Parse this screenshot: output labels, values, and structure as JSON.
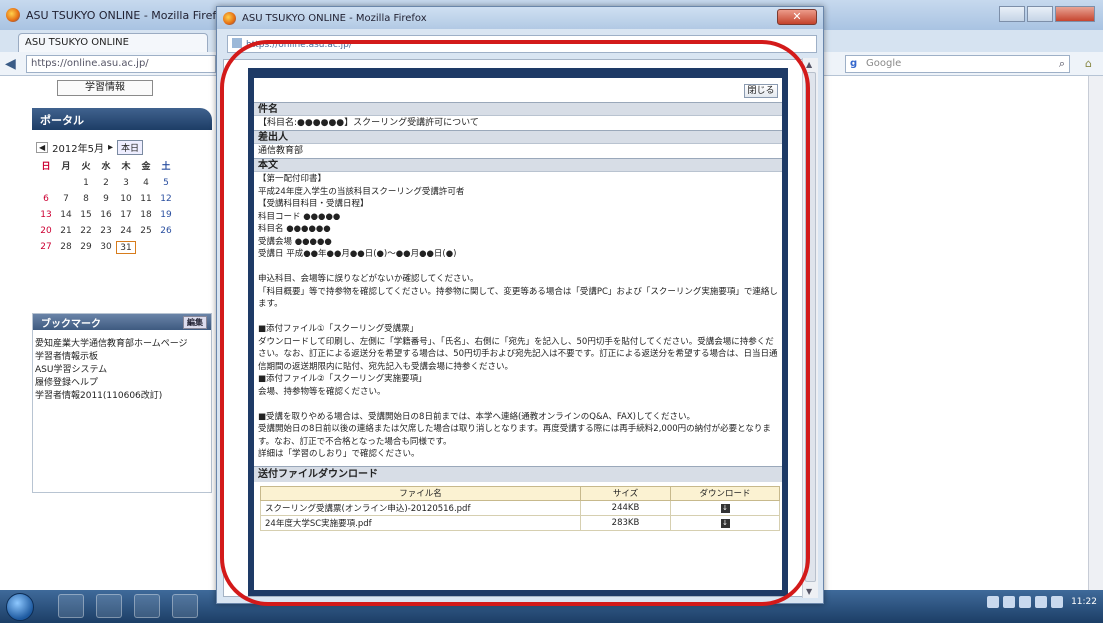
{
  "background_window": {
    "title": "ASU TSUKYO ONLINE - Mozilla Firefox",
    "tab_label": "ASU TSUKYO ONLINE",
    "url": "https://online.asu.ac.jp/",
    "search_placeholder": "Google",
    "study_info_button": "学習情報",
    "portal_title": "ポータル",
    "calendar": {
      "month_label": "2012年5月",
      "today_button": "本日",
      "weekdays": [
        "日",
        "月",
        "火",
        "水",
        "木",
        "金",
        "土"
      ],
      "days": [
        "",
        "",
        "1",
        "2",
        "3",
        "4",
        "5",
        "6",
        "7",
        "8",
        "9",
        "10",
        "11",
        "12",
        "13",
        "14",
        "15",
        "16",
        "17",
        "18",
        "19",
        "20",
        "21",
        "22",
        "23",
        "24",
        "25",
        "26",
        "27",
        "28",
        "29",
        "30",
        "31"
      ],
      "today": "31"
    },
    "bookmark_title": "ブックマーク",
    "bookmark_edit": "編集",
    "bookmarks": [
      "愛知産業大学通信教育部ホームページ",
      "学習者情報示板",
      "ASU学習システム",
      "履修登録ヘルプ",
      "学習者情報2011(110606改訂)"
    ]
  },
  "popup_window": {
    "title": "ASU TSUKYO ONLINE - Mozilla Firefox",
    "url": "https://online.asu.ac.jp/"
  },
  "mail": {
    "close_label": "閉じる",
    "subject_label": "件名",
    "subject_value": "【科目名:●●●●●●】スクーリング受講許可について",
    "sender_label": "差出人",
    "sender_value": "通信教育部",
    "body_label": "本文",
    "body_lines": [
      "【第一配付印書】",
      "平成24年度入学生の当該科目スクーリング受講許可者",
      "【受講科目科目・受講日程】",
      "科目コード ●●●●●",
      "科目名 ●●●●●●",
      "受講会場 ●●●●●",
      "受講日 平成●●年●●月●●日(●)〜●●月●●日(●)",
      "",
      "申込科目、会場等に誤りなどがないか確認してください。",
      "「科目概要」等で持参物を確認してください。持参物に関して、変更等ある場合は「受講PC」および「スクーリング実施要項」で連絡します。",
      "",
      "■添付ファイル①「スクーリング受講票」",
      "ダウンロードして印刷し、左側に「学籍番号」、「氏名」、右側に「宛先」を記入し、50円切手を貼付してください。受講会場に持参ください。なお、訂正による返送分を希望する場合は、50円切手および宛先記入は不要です。訂正による返送分を希望する場合は、日当日通信期間の返送期限内に貼付、宛先記入も受講会場に持参ください。",
      "■添付ファイル②「スクーリング実施要項」",
      "会場、持参物等を確認ください。",
      "",
      "■受講を取りやめる場合は、受講開始日の8日前までは、本学へ連絡(通教オンラインのQ&A、FAX)してください。",
      "受講開始日の8日前以後の連絡または欠席した場合は取り消しとなります。再度受講する際には再手続料2,000円の納付が必要となります。なお、訂正で不合格となった場合も同様です。",
      "詳細は「学習のしおり」で確認ください。"
    ],
    "download_label": "送付ファイルダウンロード",
    "table_headers": [
      "ファイル名",
      "サイズ",
      "ダウンロード"
    ],
    "files": [
      {
        "name": "スクーリング受講票(オンライン申込)-20120516.pdf",
        "size": "244KB"
      },
      {
        "name": "24年度大学SC実施要項.pdf",
        "size": "283KB"
      }
    ]
  },
  "taskbar": {
    "clock": "11:22"
  },
  "colors": {
    "annotation": "#d31a1a",
    "mail_frame": "#1e3a66"
  }
}
